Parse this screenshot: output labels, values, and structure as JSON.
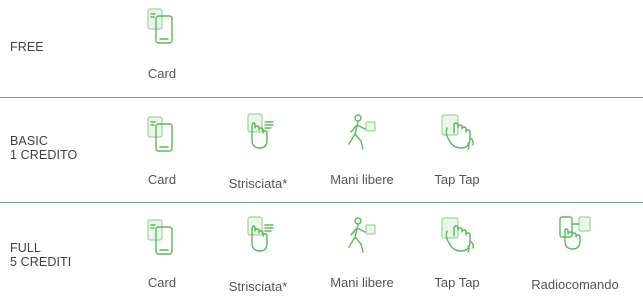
{
  "plans": [
    {
      "label": "FREE",
      "features": [
        {
          "label": "Card",
          "icon": "card-phone-icon"
        }
      ]
    },
    {
      "label": "BASIC\n1 CREDITO",
      "features": [
        {
          "label": "Card",
          "icon": "card-phone-icon"
        },
        {
          "label": "Strisciata*",
          "icon": "swipe-hand-icon"
        },
        {
          "label": "Mani libere",
          "icon": "hands-free-walker-icon"
        },
        {
          "label": "Tap Tap",
          "icon": "tap-tap-hand-icon"
        }
      ]
    },
    {
      "label": "FULL\n5 CREDITI",
      "features": [
        {
          "label": "Card",
          "icon": "card-phone-icon"
        },
        {
          "label": "Strisciata*",
          "icon": "swipe-hand-icon"
        },
        {
          "label": "Mani libere",
          "icon": "hands-free-walker-icon"
        },
        {
          "label": "Tap Tap",
          "icon": "tap-tap-hand-icon"
        },
        {
          "label": "Radiocomando",
          "icon": "remote-control-icon"
        }
      ]
    }
  ],
  "colors": {
    "icon_green": "#5cb85c",
    "divider": "#7f9a87",
    "text": "#4a4a4a"
  }
}
